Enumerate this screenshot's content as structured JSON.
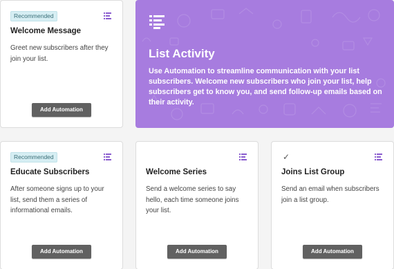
{
  "hero": {
    "icon": "list-icon",
    "title": "List Activity",
    "description": "Use Automation to streamline communication with your list subscribers. Welcome new subscribers who join your list, help subscribers get to know you, and send follow-up emails based on their activity.",
    "background_color": "#a77cdf"
  },
  "cards": [
    {
      "badge": "Recommended",
      "title": "Welcome Message",
      "description": "Greet new subscribers after they join your list.",
      "button_label": "Add Automation",
      "icon": "list-menu-icon"
    },
    {
      "badge": "Recommended",
      "title": "Educate Subscribers",
      "description": "After someone signs up to your list, send them a series of informational emails.",
      "button_label": "Add Automation",
      "icon": "list-menu-icon"
    },
    {
      "title": "Welcome Series",
      "description": "Send a welcome series to say hello, each time someone joins your list.",
      "button_label": "Add Automation",
      "icon": "list-menu-icon"
    },
    {
      "status_icon": "checkmark-icon",
      "title": "Joins List Group",
      "description": "Send an email when subscribers join a list group.",
      "button_label": "Add Automation",
      "icon": "list-menu-icon"
    }
  ],
  "colors": {
    "accent_purple": "#8a5ccf",
    "button_gray": "#616161",
    "badge_bg": "#d6eef3"
  }
}
